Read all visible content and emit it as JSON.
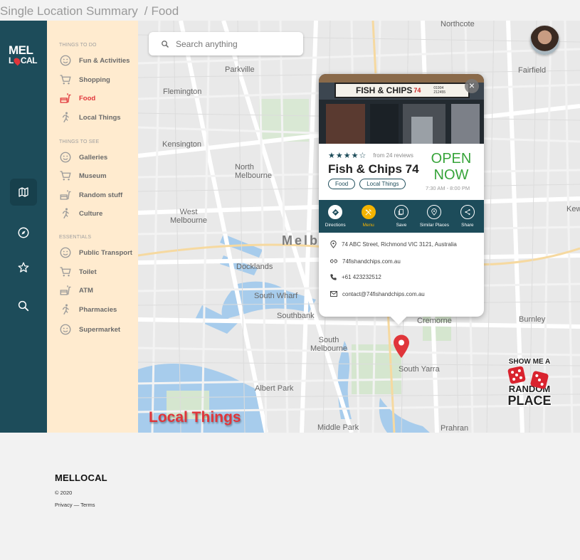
{
  "breadcrumb": {
    "page": "Single Location Summary",
    "separator": "/",
    "section": "Food"
  },
  "logo": {
    "line1": "MEL",
    "line2_pre": "L",
    "line2_post": "CAL"
  },
  "rail": {
    "items": [
      "map-icon",
      "compass-icon",
      "star-icon",
      "search-icon"
    ]
  },
  "panel": {
    "sections": [
      {
        "title": "THINGS TO DO",
        "items": [
          "Fun & Activities",
          "Shopping",
          "Food",
          "Local Things"
        ]
      },
      {
        "title": "THINGS TO SEE",
        "items": [
          "Galleries",
          "Museum",
          "Random stuff",
          "Culture"
        ]
      },
      {
        "title": "ESSENTIALS",
        "items": [
          "Public Transport",
          "Toilet",
          "ATM",
          "Pharmacies",
          "Supermarket"
        ]
      }
    ],
    "active": "Food"
  },
  "search": {
    "placeholder": "Search anything"
  },
  "map": {
    "labels": {
      "northcote": "Northcote",
      "parkville": "Parkville",
      "fairfield": "Fairfield",
      "flemington": "Flemington",
      "kensington": "Kensington",
      "north_melbourne": "North Melbourne",
      "west_melbourne": "West Melbourne",
      "melbourne": "Melb",
      "docklands": "Docklands",
      "south_wharf": "South Wharf",
      "southbank": "Southbank",
      "south_melbourne": "South Melbourne",
      "albert_park": "Albert Park",
      "middle_park": "Middle Park",
      "cremorne": "Cremorne",
      "burnley": "Burnley",
      "south_yarra": "South Yarra",
      "prahran": "Prahran",
      "kew": "Kew"
    }
  },
  "place": {
    "photo_sign": "FISH & CHIPS",
    "photo_sign_num": "74",
    "photo_sign_phone_1": "01904",
    "photo_sign_phone_2": "212455",
    "rating": 4,
    "reviews": "from 24 reviews",
    "name": "Fish & Chips 74",
    "tags": [
      "Food",
      "Local Things"
    ],
    "status_line1": "OPEN",
    "status_line2": "NOW",
    "hours": "7:30 AM - 8:00 PM",
    "actions": [
      "Directions",
      "Menu",
      "Save",
      "Similar Places",
      "Share"
    ],
    "address": "74 ABC Street, Richmond VIC  3121, Australia",
    "website": "74fishandchips.com.au",
    "phone": "+61 423232512",
    "email": "contact@74fishandchips.com.au"
  },
  "random": {
    "line1": "SHOW ME A",
    "line2": "RANDOM",
    "line3": "PLACE"
  },
  "page_title": "Local Things",
  "footer": {
    "brand": "MELLOCAL",
    "copyright": "© 2020",
    "privacy": "Privacy",
    "dash": "—",
    "terms": "Terms"
  },
  "colors": {
    "rail": "#1d4c5a",
    "panel": "#ffebcf",
    "accent_red": "#e0353a",
    "open_green": "#37a43a",
    "menu_yellow": "#f5b400"
  }
}
